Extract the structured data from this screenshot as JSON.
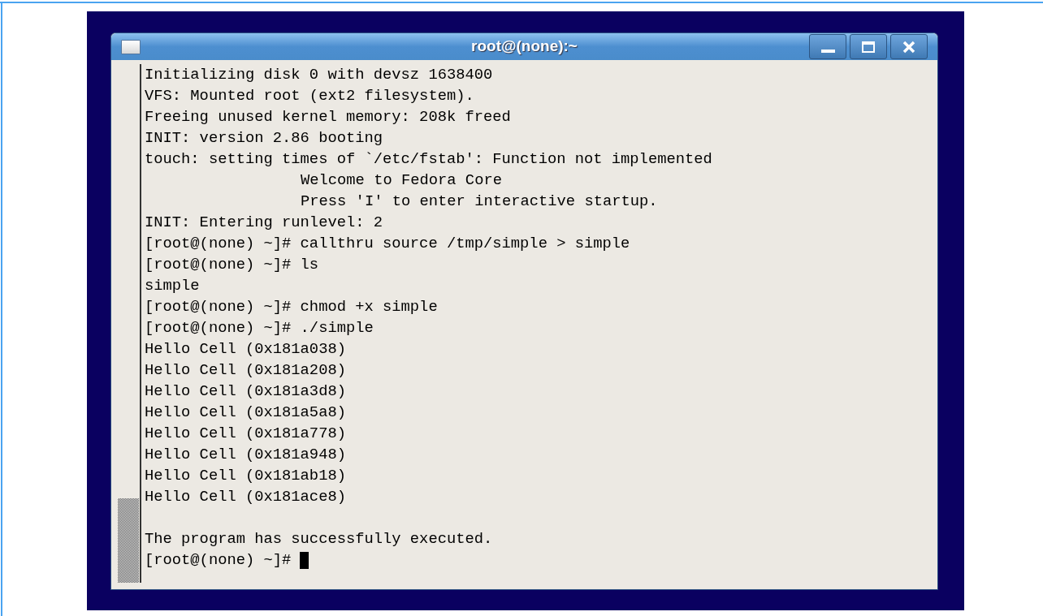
{
  "window": {
    "title": "root@(none):~"
  },
  "terminal": {
    "lines": [
      {
        "kind": "output",
        "text": "Initializing disk 0 with devsz 1638400"
      },
      {
        "kind": "output",
        "text": "VFS: Mounted root (ext2 filesystem)."
      },
      {
        "kind": "output",
        "text": "Freeing unused kernel memory: 208k freed"
      },
      {
        "kind": "output",
        "text": "INIT: version 2.86 booting"
      },
      {
        "kind": "output",
        "text": "touch: setting times of `/etc/fstab': Function not implemented"
      },
      {
        "kind": "indented",
        "text": "Welcome to Fedora Core"
      },
      {
        "kind": "indented",
        "text": "Press 'I' to enter interactive startup."
      },
      {
        "kind": "output",
        "text": "INIT: Entering runlevel: 2"
      },
      {
        "kind": "output",
        "text": "[root@(none) ~]# callthru source /tmp/simple > simple"
      },
      {
        "kind": "output",
        "text": "[root@(none) ~]# ls"
      },
      {
        "kind": "output",
        "text": "simple"
      },
      {
        "kind": "output",
        "text": "[root@(none) ~]# chmod +x simple"
      },
      {
        "kind": "output",
        "text": "[root@(none) ~]# ./simple"
      },
      {
        "kind": "output",
        "text": "Hello Cell (0x181a038)"
      },
      {
        "kind": "output",
        "text": "Hello Cell (0x181a208)"
      },
      {
        "kind": "output",
        "text": "Hello Cell (0x181a3d8)"
      },
      {
        "kind": "output",
        "text": "Hello Cell (0x181a5a8)"
      },
      {
        "kind": "output",
        "text": "Hello Cell (0x181a778)"
      },
      {
        "kind": "output",
        "text": "Hello Cell (0x181a948)"
      },
      {
        "kind": "output",
        "text": "Hello Cell (0x181ab18)"
      },
      {
        "kind": "output",
        "text": "Hello Cell (0x181ace8)"
      },
      {
        "kind": "blank"
      },
      {
        "kind": "output",
        "text": "The program has successfully executed."
      },
      {
        "kind": "prompt",
        "text": "[root@(none) ~]#"
      }
    ]
  }
}
